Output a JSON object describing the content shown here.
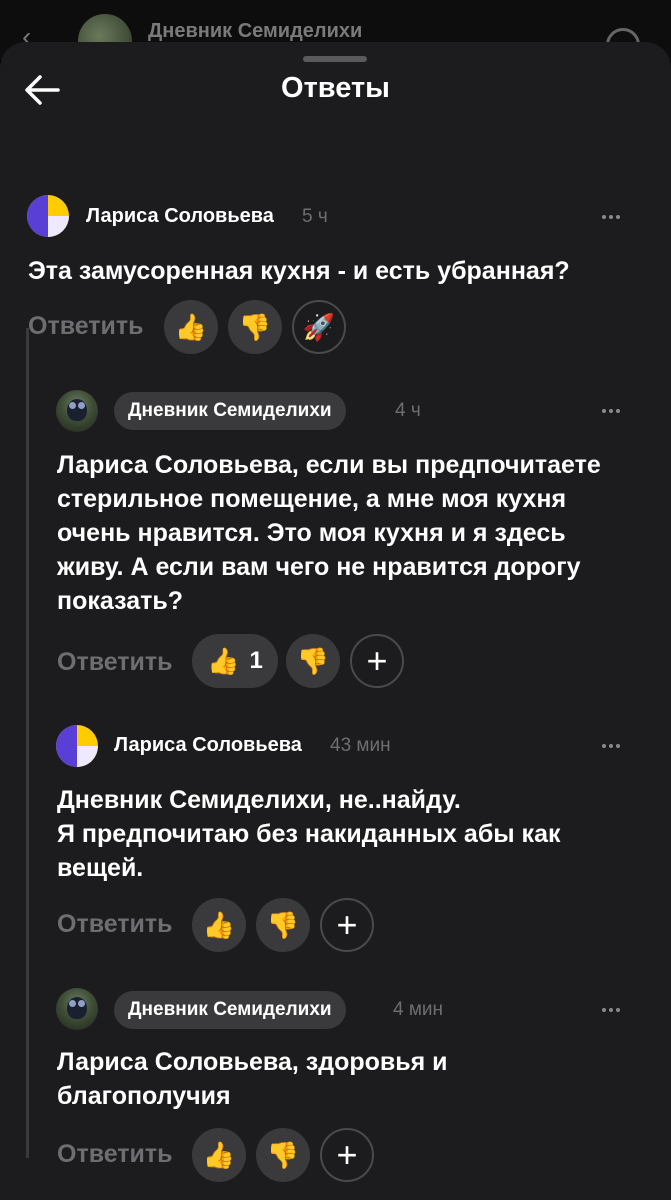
{
  "background": {
    "title": "Дневник Семиделихи"
  },
  "sheet": {
    "title": "Ответы"
  },
  "comments": [
    {
      "author": "Лариса Соловьева",
      "time": "5 ч",
      "text": "Эта замусоренная кухня - и есть убранная?",
      "reply_label": "Ответить"
    },
    {
      "author": "Дневник Семиделихи",
      "time": "4 ч",
      "text": "Лариса Соловьева, если вы предпочитаете стерильное помещение, а мне моя кухня очень нравится. Это моя кухня и я здесь живу. А если вам чего не нравится дорогу показать?",
      "reply_label": "Ответить",
      "likes": "1"
    },
    {
      "author": "Лариса Соловьева",
      "time": "43 мин",
      "text_line1": "Дневник Семиделихи, не..найду.",
      "text_line2": "Я предпочитаю без накиданных абы как вещей.",
      "reply_label": "Ответить"
    },
    {
      "author": "Дневник Семиделихи",
      "time": "4 мин",
      "text": "Лариса Соловьева, здоровья и благополучия",
      "reply_label": "Ответить"
    }
  ],
  "icons": {
    "like": "thumbs-up-icon",
    "dislike": "thumbs-down-icon",
    "rocket": "rocket-icon",
    "add": "plus-icon",
    "more": "more-dots-icon",
    "back": "arrow-left-icon"
  }
}
